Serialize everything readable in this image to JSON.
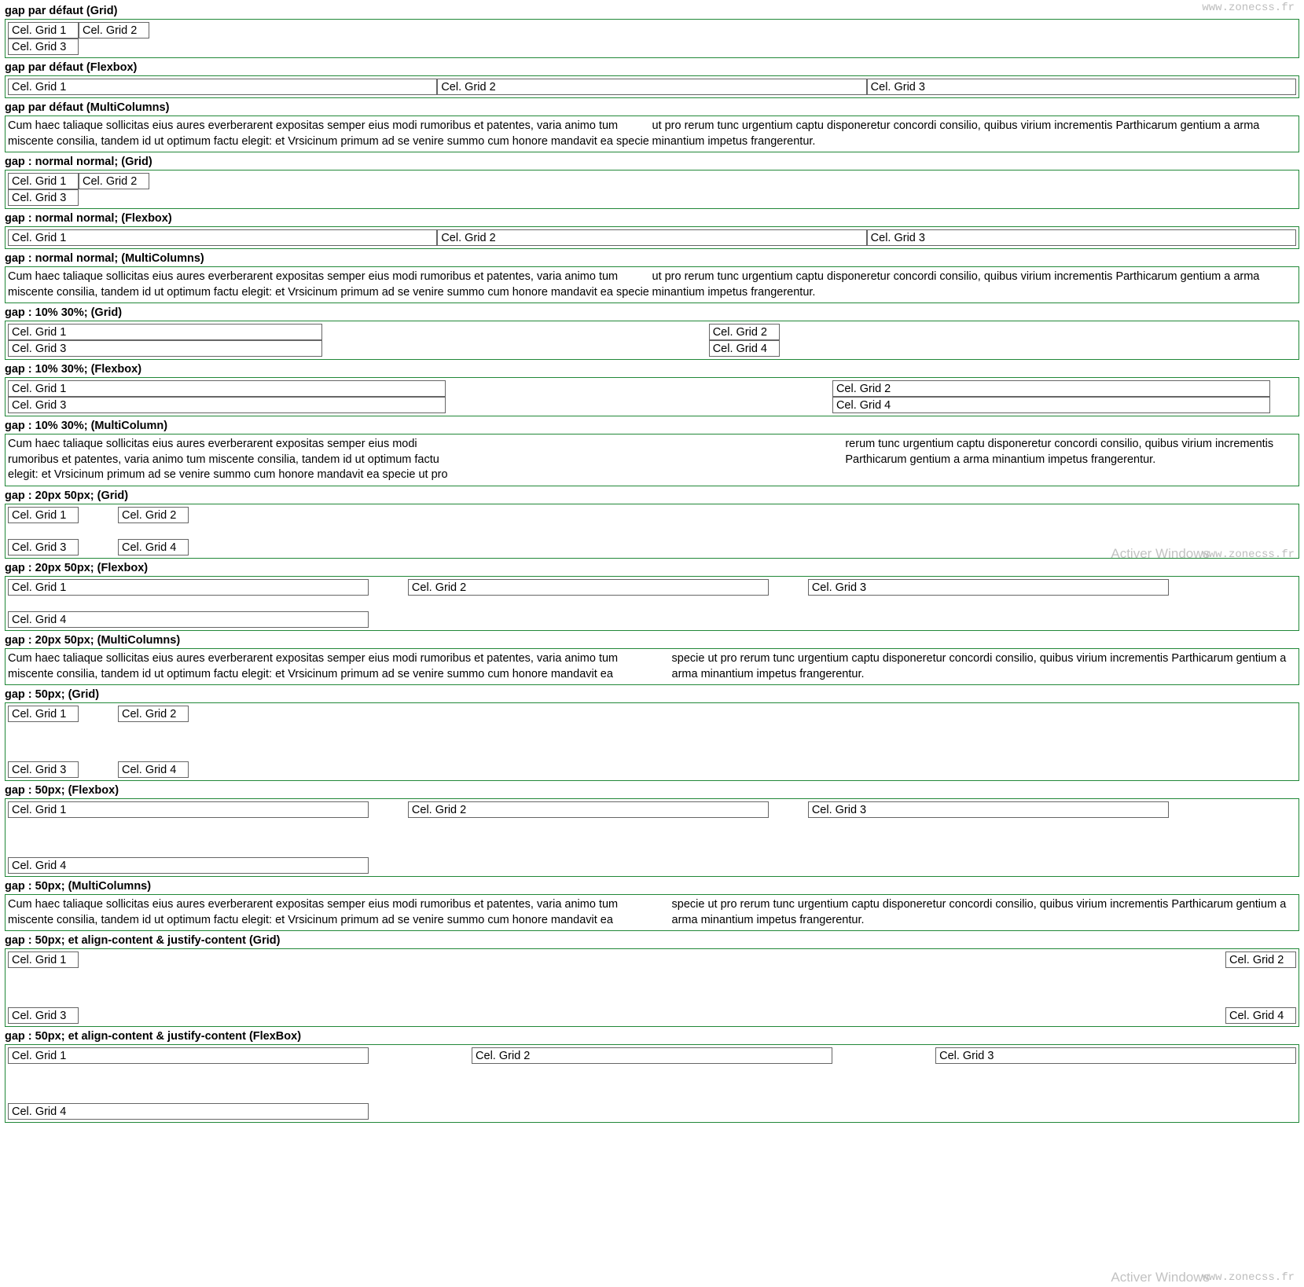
{
  "watermarks": {
    "top": "www.zonecss.fr",
    "mid": "www.zonecss.fr",
    "bot": "www.zonecss.fr"
  },
  "activate": {
    "mid": "Activer Windows",
    "bot": "Activer Windows"
  },
  "cells": {
    "c1": "Cel. Grid 1",
    "c2": "Cel. Grid 2",
    "c3": "Cel. Grid 3",
    "c4": "Cel. Grid 4"
  },
  "lorem0": "Cum haec taliaque sollicitas eius aures everberarent expositas semper eius modi rumoribus et patentes, varia animo tum miscente consilia, tandem id ut optimum factu elegit: et Vrsicinum primum ad se venire summo cum honore mandavit ea specie ut pro rerum tunc urgentium captu disponeretur concordi consilio, quibus virium incrementis Parthicarum gentium a arma minantium impetus frangerentur.",
  "lorem10": "Cum haec taliaque sollicitas eius aures everberarent expositas semper eius modi rumoribus et patentes, varia animo tum miscente consilia, tandem id ut optimum factu elegit: et Vrsicinum primum ad se venire summo cum honore mandavit ea specie ut pro rerum tunc urgentium captu disponeretur concordi consilio, quibus virium incrementis Parthicarum gentium a arma minantium impetus frangerentur.",
  "lorem20": "Cum haec taliaque sollicitas eius aures everberarent expositas semper eius modi rumoribus et patentes, varia animo tum miscente consilia, tandem id ut optimum factu elegit: et Vrsicinum primum ad se venire summo cum honore mandavit ea specie ut pro rerum tunc urgentium captu disponeretur concordi consilio, quibus virium incrementis Parthicarum gentium a arma minantium impetus frangerentur.",
  "lorem50": "Cum haec taliaque sollicitas eius aures everberarent expositas semper eius modi rumoribus et patentes, varia animo tum miscente consilia, tandem id ut optimum factu elegit: et Vrsicinum primum ad se venire summo cum honore mandavit ea specie ut pro rerum tunc urgentium captu disponeretur concordi consilio, quibus virium incrementis Parthicarum gentium a arma minantium impetus frangerentur.",
  "headings": {
    "h1": "gap par défaut (Grid)",
    "h2": "gap par défaut (Flexbox)",
    "h3": "gap par défaut (MultiColumns)",
    "h4": "gap : normal normal; (Grid)",
    "h5": "gap : normal normal; (Flexbox)",
    "h6": "gap : normal normal; (MultiColumns)",
    "h7": "gap : 10% 30%; (Grid)",
    "h8": "gap : 10% 30%; (Flexbox)",
    "h9": "gap : 10% 30%; (MultiColumn)",
    "h10": "gap : 20px 50px; (Grid)",
    "h11": "gap : 20px 50px; (Flexbox)",
    "h12": "gap : 20px 50px; (MultiColumns)",
    "h13": "gap : 50px; (Grid)",
    "h14": "gap : 50px; (Flexbox)",
    "h15": "gap : 50px; (MultiColumns)",
    "h16": "gap : 50px; et align-content & justify-content (Grid)",
    "h17": "gap : 50px; et align-content & justify-content (FlexBox)"
  }
}
